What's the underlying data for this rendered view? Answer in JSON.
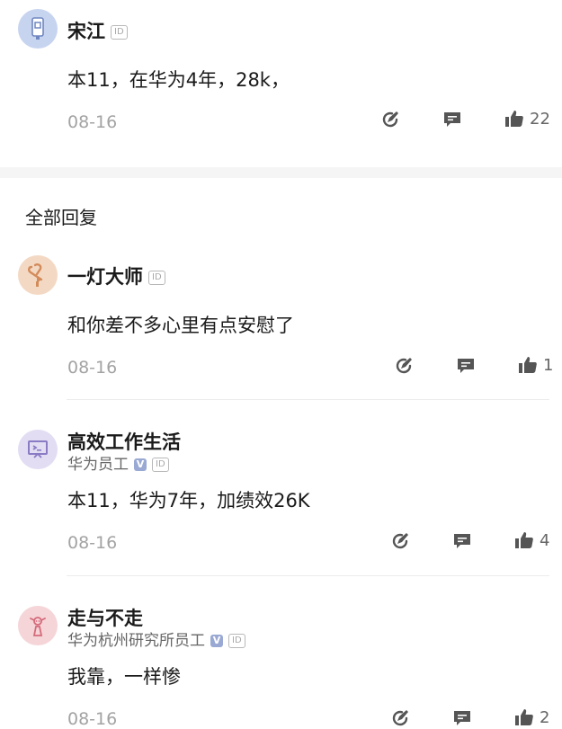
{
  "post": {
    "author": "宋江",
    "id_badge": "ID",
    "content": "本11，在华为4年，28k，",
    "date": "08-16",
    "like_count": "22",
    "avatar_icon": "usb-drive-icon",
    "avatar_bg": "#c7d4f0"
  },
  "section": {
    "title": "全部回复"
  },
  "replies": [
    {
      "author": "一灯大师",
      "id_badge": "ID",
      "content": "和你差不多心里有点安慰了",
      "date": "08-16",
      "like_count": "1",
      "avatar_icon": "hook-arrow-icon",
      "avatar_bg": "#f3d9c4"
    },
    {
      "author": "高效工作生活",
      "subtitle": "华为员工",
      "verified": "V",
      "id_badge": "ID",
      "content": "本11，华为7年，加绩效26K",
      "date": "08-16",
      "like_count": "4",
      "avatar_icon": "presentation-board-icon",
      "avatar_bg": "#e2ddf3"
    },
    {
      "author": "走与不走",
      "subtitle": "华为杭州研究所员工",
      "verified": "V",
      "id_badge": "ID",
      "content": "我靠，一样惨",
      "date": "08-16",
      "like_count": "2",
      "avatar_icon": "bow-figure-icon",
      "avatar_bg": "#f5d5d8"
    }
  ],
  "colors": {
    "icon": "#555555",
    "muted": "#a3a3a3",
    "divider": "#ececec"
  }
}
